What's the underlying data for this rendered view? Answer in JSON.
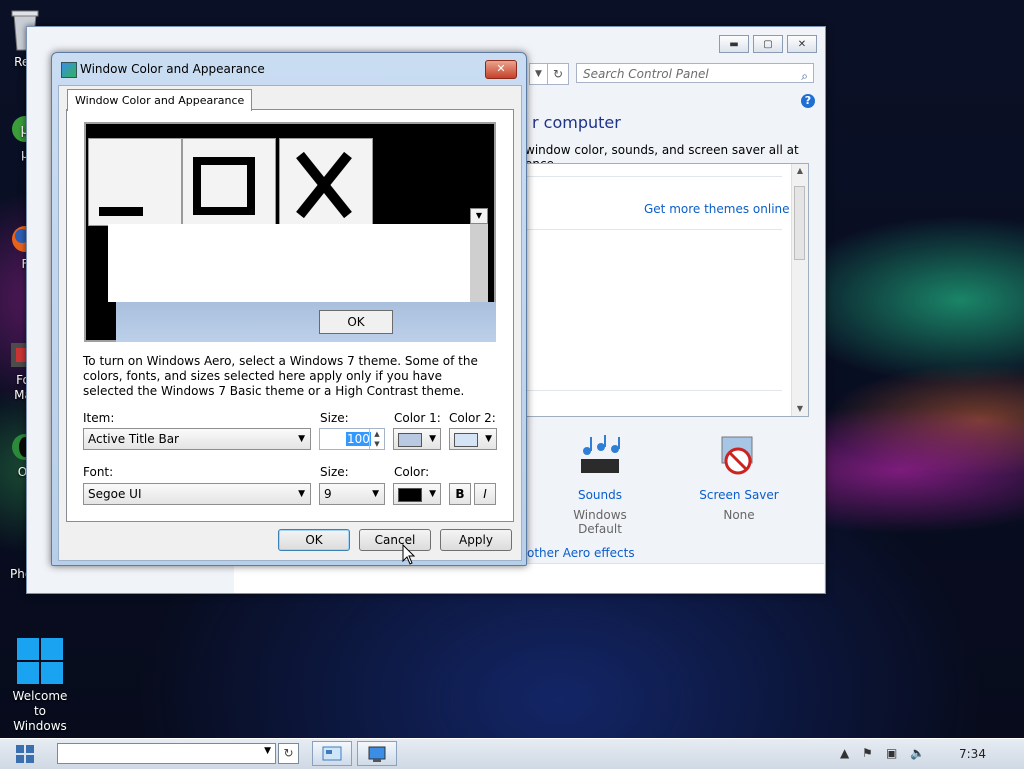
{
  "desktop": {
    "icons": [
      {
        "name": "recycle-bin",
        "label": "Rec"
      },
      {
        "name": "utorrent",
        "label": "µ"
      },
      {
        "name": "firefox",
        "label": "F"
      },
      {
        "name": "format-factory",
        "label_line1": "Fo",
        "label_line2": "Ma"
      },
      {
        "name": "opera",
        "label": "Or"
      },
      {
        "name": "photoshop",
        "label": "Photoshop"
      },
      {
        "name": "welcome-windows",
        "label_line1": "Welcome to",
        "label_line2": "Windows ..."
      }
    ]
  },
  "control_panel": {
    "search_placeholder": "Search Control Panel",
    "help": "?",
    "heading": "r computer",
    "description": "window color, sounds, and screen saver all at once.",
    "get_more_themes": "Get more themes online",
    "sounds": {
      "label": "Sounds",
      "value": "Windows Default"
    },
    "screen_saver": {
      "label": "Screen Saver",
      "value": "None"
    },
    "aero_link": "other Aero effects"
  },
  "dialog": {
    "title": "Window Color and Appearance",
    "close_label": "✕",
    "tab_label": "Window Color and Appearance",
    "preview_ok": "OK",
    "info_text": "To turn on Windows Aero, select a Windows 7 theme.  Some of the colors, fonts, and sizes selected here apply only if you have selected the Windows 7 Basic theme or a High Contrast theme.",
    "item_label": "Item:",
    "item_value": "Active Title Bar",
    "size_label": "Size:",
    "size_value": "100",
    "color1_label": "Color 1:",
    "color2_label": "Color 2:",
    "color1": "#b9c9e1",
    "color2": "#d4e3f6",
    "font_label": "Font:",
    "font_value": "Segoe UI",
    "font_size_label": "Size:",
    "font_size_value": "9",
    "font_color_label": "Color:",
    "font_color": "#000000",
    "bold_label": "B",
    "italic_label": "I",
    "buttons": {
      "ok": "OK",
      "cancel": "Cancel",
      "apply": "Apply"
    }
  },
  "taskbar": {
    "clock": "7:34"
  }
}
